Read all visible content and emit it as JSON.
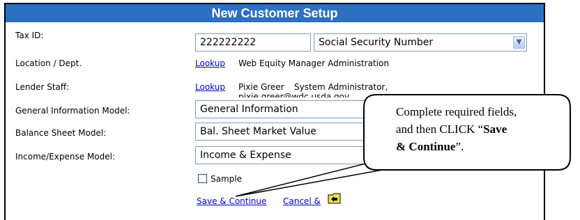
{
  "window": {
    "title": "New Customer Setup"
  },
  "form": {
    "tax_id": {
      "label": "Tax ID:",
      "value": "222222222",
      "type_value": "Social Security Number"
    },
    "location": {
      "label": "Location / Dept.",
      "lookup": "Lookup",
      "value": "Web Equity Manager Administration"
    },
    "lender_staff": {
      "label": "Lender Staff:",
      "lookup": "Lookup",
      "name": "Pixie Greer",
      "role": "System Administrator,",
      "email": "pixie.greer@wdc.usda.gov"
    },
    "general_model": {
      "label": "General Information Model:",
      "value": "General Information"
    },
    "balance_model": {
      "label": "Balance Sheet Model:",
      "value": "Bal. Sheet Market Value"
    },
    "income_model": {
      "label": "Income/Expense Model:",
      "value": "Income & Expense"
    },
    "sample": {
      "label": "Sample",
      "checked": false
    },
    "actions": {
      "save": "Save & Continue",
      "cancel": "Cancel &"
    }
  },
  "callout": {
    "line1": "Complete required fields,",
    "line2a": "and then CLICK “",
    "line2b": "Save",
    "line3a": "& Continue",
    "line3b": "”."
  },
  "colors": {
    "title_bar": "#2d6fc0",
    "link": "#0000cc"
  }
}
